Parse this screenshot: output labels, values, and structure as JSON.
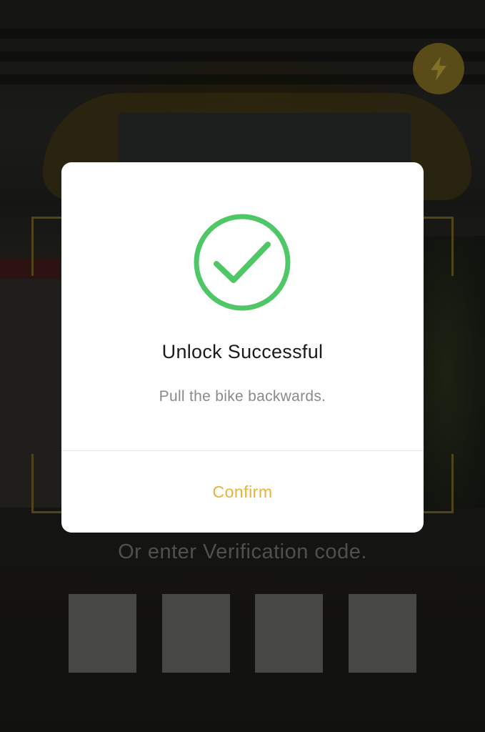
{
  "scanner": {
    "verify_label": "Or enter Verification code.",
    "code_digits": [
      "",
      "",
      "",
      ""
    ],
    "flash_icon": "lightning-bolt-icon"
  },
  "dialog": {
    "icon": "checkmark-circle-icon",
    "title": "Unlock Successful",
    "message": "Pull the bike backwards.",
    "confirm_label": "Confirm"
  },
  "colors": {
    "accent": "#e8b339",
    "success": "#4fc767",
    "flash_button": "#8a7626"
  }
}
